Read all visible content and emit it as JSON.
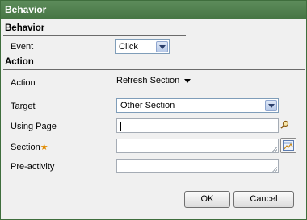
{
  "dialog": {
    "title": "Behavior"
  },
  "behavior": {
    "header": "Behavior",
    "event_label": "Event",
    "event_value": "Click"
  },
  "action": {
    "header": "Action",
    "action_label": "Action",
    "action_value": "Refresh Section",
    "target_label": "Target",
    "target_value": "Other Section",
    "using_page_label": "Using Page",
    "using_page_value": "",
    "section_label": "Section",
    "required_marker": "★",
    "section_value": "",
    "preactivity_label": "Pre-activity",
    "preactivity_value": ""
  },
  "buttons": {
    "ok": "OK",
    "cancel": "Cancel"
  },
  "icons": {
    "search": "magnifier-icon",
    "section_picker": "section-picker-icon",
    "dropdown": "chevron-down-icon"
  },
  "colors": {
    "titlebar": "#4f7f4d",
    "required": "#e08a00"
  }
}
